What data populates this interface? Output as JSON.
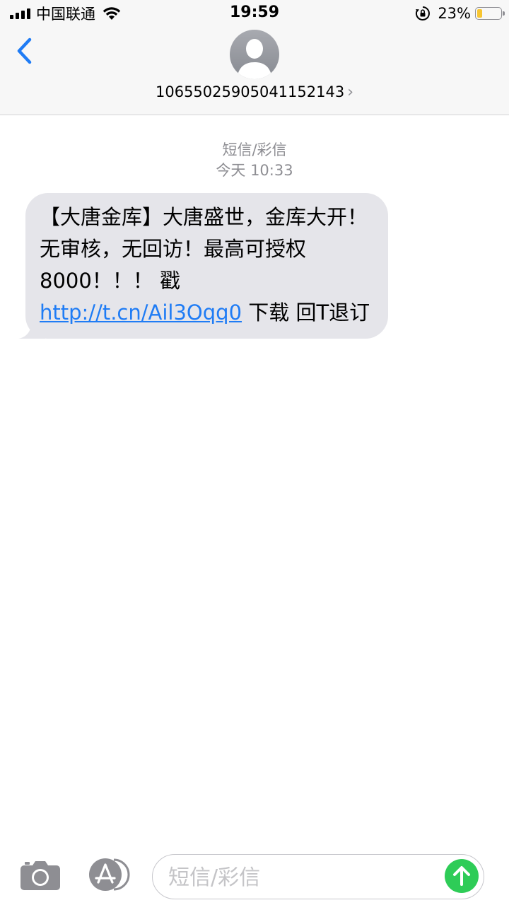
{
  "status_bar": {
    "carrier": "中国联通",
    "time": "19:59",
    "battery_percent": "23%",
    "battery_level": 0.23,
    "icons": [
      "signal-icon",
      "wifi-icon",
      "rotation-lock-icon",
      "battery-icon"
    ]
  },
  "header": {
    "back_icon": "chevron-left-icon",
    "avatar_icon": "person-icon",
    "contact_number": "10655025905041152143",
    "contact_chevron": "›"
  },
  "conversation": {
    "message_type": "短信/彩信",
    "timestamp": "今天 10:33",
    "messages": [
      {
        "direction": "incoming",
        "text_before_link": "【大唐金库】大唐盛世，金库大开！无审核，无回访！最高可授权8000！！！ 戳 ",
        "link": "http://t.cn/Ail3Oqq0",
        "text_after_link": " 下载 回T退订"
      }
    ]
  },
  "input_bar": {
    "camera_icon": "camera-icon",
    "apps_icon": "app-store-icon",
    "placeholder": "短信/彩信",
    "value": "",
    "send_icon": "arrow-up-icon"
  },
  "colors": {
    "accent": "#1f7cf5",
    "bubble_incoming": "#e5e5ea",
    "send_button": "#2ecc57",
    "secondary_text": "#8e8e93",
    "battery_fill": "#f7c531"
  }
}
